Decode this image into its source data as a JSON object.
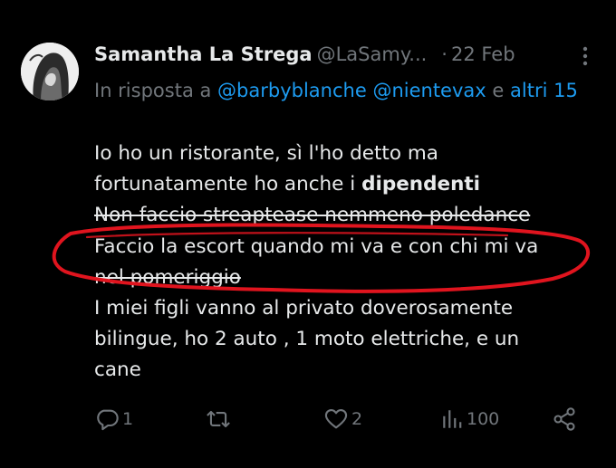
{
  "tweet": {
    "author_name": "Samantha La Strega",
    "author_handle": "@LaSamy...",
    "dot": "·",
    "date": "22 Feb",
    "reply_prefix": "In risposta a",
    "reply_mention_1": "@barbyblanche",
    "reply_mention_2": "@nientevax",
    "reply_connector": "e",
    "reply_others": "altri 15",
    "lines": {
      "l1": "Io ho un ristorante, sì l'ho detto ma",
      "l2_pre": "fortunatamente ho anche i ",
      "l2_bold": "dipendenti",
      "l3": "Non faccio streaptease nemmeno poledance",
      "l4": "Faccio la escort quando mi va e con chi mi va",
      "l5": "nel pomeriggio",
      "l6": "I miei figli vanno al privato doverosamente",
      "l7": "bilingue, ho 2 auto , 1 moto elettriche, e un",
      "l8": "cane"
    },
    "actions": {
      "replies": "1",
      "retweets": "",
      "likes": "2",
      "views": "100"
    }
  },
  "colors": {
    "background": "#000000",
    "text": "#e7e9ea",
    "muted": "#71767b",
    "link": "#1d9bf0",
    "annotation": "#e0141e"
  },
  "icons": [
    "more-vertical-icon",
    "reply-icon",
    "retweet-icon",
    "heart-icon",
    "views-icon",
    "share-icon"
  ]
}
